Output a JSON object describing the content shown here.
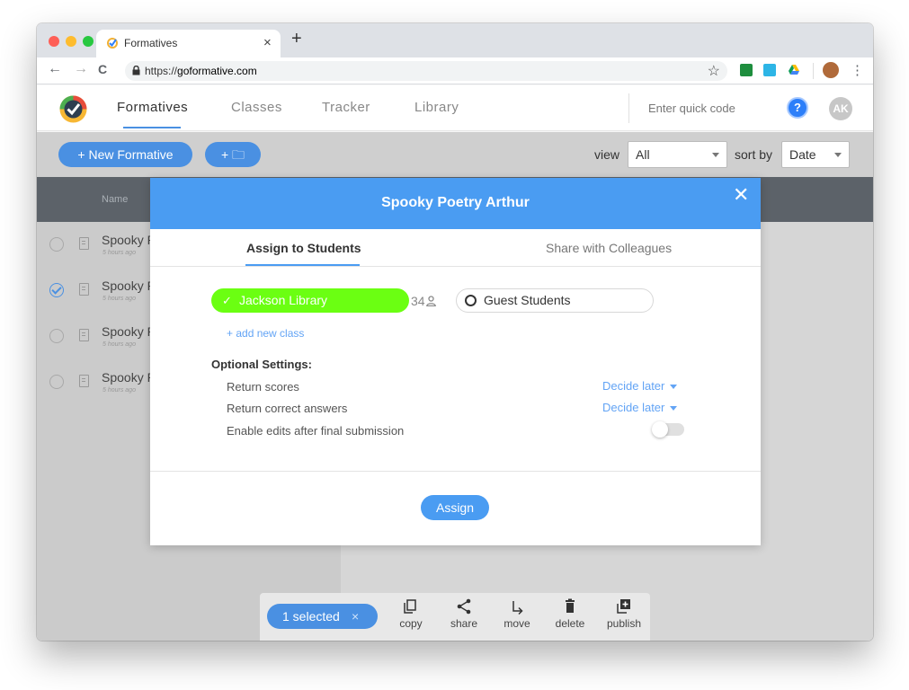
{
  "browser": {
    "tab_title": "Formatives",
    "tab_close": "×",
    "new_tab": "+",
    "url_prefix": "https://",
    "url_domain": "goformative.com",
    "back": "←",
    "forward": "→",
    "reload": "C",
    "bookmark": "☆",
    "menu": "⋮",
    "colors": {
      "red": "#fe5f57",
      "yellow": "#febc2e",
      "green": "#28c840"
    }
  },
  "app": {
    "nav": [
      "Formatives",
      "Classes",
      "Tracker",
      "Library"
    ],
    "quick_code_placeholder": "Enter quick code",
    "help": "?",
    "avatar": "AK",
    "accent": "#4a90e2"
  },
  "toolbar": {
    "new_formative": "+ New Formative",
    "new_folder": "+ 🗀",
    "view_label": "view",
    "view_value": "All",
    "sort_label": "sort by",
    "sort_value": "Date"
  },
  "table": {
    "name_header": "Name",
    "rows": [
      {
        "title": "Spooky P",
        "time": "5 hours ago",
        "selected": false
      },
      {
        "title": "Spooky P",
        "time": "5 hours ago",
        "selected": true
      },
      {
        "title": "Spooky P",
        "time": "5 hours ago",
        "selected": false
      },
      {
        "title": "Spooky P",
        "time": "5 hours ago",
        "selected": false
      }
    ]
  },
  "modal": {
    "title": "Spooky Poetry Arthur",
    "close": "✕",
    "tabs": [
      "Assign to Students",
      "Share with Colleagues"
    ],
    "class_name": "Jackson Library",
    "class_check": "✓",
    "student_count": "34",
    "guest_students": "Guest Students",
    "add_class": "+ add new class",
    "optional_title": "Optional Settings:",
    "settings": [
      {
        "label": "Return scores",
        "value": "Decide later"
      },
      {
        "label": "Return correct answers",
        "value": "Decide later"
      },
      {
        "label": "Enable edits after final submission",
        "value": ""
      }
    ],
    "enable_edits_on": false,
    "assign_button": "Assign",
    "class_color": "#6bff12"
  },
  "actionbar": {
    "selected": "1 selected",
    "clear": "×",
    "actions": [
      "copy",
      "share",
      "move",
      "delete",
      "publish"
    ]
  }
}
